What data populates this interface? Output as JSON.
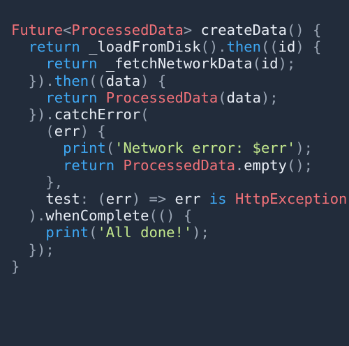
{
  "editor": {
    "colors": {
      "background": "#222c3b",
      "type": "#f07178",
      "keyword": "#3fa9f5",
      "plain": "#e8edf5",
      "punctuation": "#9aa5b4",
      "string": "#c3e88d"
    },
    "lines": [
      {
        "tokens": [
          {
            "t": "Future",
            "c": "type"
          },
          {
            "t": "<",
            "c": "punc"
          },
          {
            "t": "ProcessedData",
            "c": "type"
          },
          {
            "t": "> ",
            "c": "punc"
          },
          {
            "t": "createData",
            "c": "plain"
          },
          {
            "t": "() {",
            "c": "punc"
          }
        ]
      },
      {
        "tokens": [
          {
            "t": "  ",
            "c": "plain"
          },
          {
            "t": "return ",
            "c": "kw"
          },
          {
            "t": "_loadFromDisk",
            "c": "plain"
          },
          {
            "t": "().",
            "c": "punc"
          },
          {
            "t": "then",
            "c": "kw"
          },
          {
            "t": "((",
            "c": "punc"
          },
          {
            "t": "id",
            "c": "plain"
          },
          {
            "t": ") {",
            "c": "punc"
          }
        ]
      },
      {
        "tokens": [
          {
            "t": "    ",
            "c": "plain"
          },
          {
            "t": "return ",
            "c": "kw"
          },
          {
            "t": "_fetchNetworkData",
            "c": "plain"
          },
          {
            "t": "(",
            "c": "punc"
          },
          {
            "t": "id",
            "c": "plain"
          },
          {
            "t": ");",
            "c": "punc"
          }
        ]
      },
      {
        "tokens": [
          {
            "t": "  }).",
            "c": "punc"
          },
          {
            "t": "then",
            "c": "kw"
          },
          {
            "t": "((",
            "c": "punc"
          },
          {
            "t": "data",
            "c": "plain"
          },
          {
            "t": ") {",
            "c": "punc"
          }
        ]
      },
      {
        "tokens": [
          {
            "t": "    ",
            "c": "plain"
          },
          {
            "t": "return ",
            "c": "kw"
          },
          {
            "t": "ProcessedData",
            "c": "type"
          },
          {
            "t": "(",
            "c": "punc"
          },
          {
            "t": "data",
            "c": "plain"
          },
          {
            "t": ");",
            "c": "punc"
          }
        ]
      },
      {
        "tokens": [
          {
            "t": "  }).",
            "c": "punc"
          },
          {
            "t": "catchError",
            "c": "plain"
          },
          {
            "t": "(",
            "c": "punc"
          }
        ]
      },
      {
        "tokens": [
          {
            "t": "    (",
            "c": "punc"
          },
          {
            "t": "err",
            "c": "plain"
          },
          {
            "t": ") {",
            "c": "punc"
          }
        ]
      },
      {
        "tokens": [
          {
            "t": "      ",
            "c": "plain"
          },
          {
            "t": "print",
            "c": "kw"
          },
          {
            "t": "(",
            "c": "punc"
          },
          {
            "t": "'Network error: $err'",
            "c": "str"
          },
          {
            "t": ");",
            "c": "punc"
          }
        ]
      },
      {
        "tokens": [
          {
            "t": "      ",
            "c": "plain"
          },
          {
            "t": "return ",
            "c": "kw"
          },
          {
            "t": "ProcessedData",
            "c": "type"
          },
          {
            "t": ".",
            "c": "punc"
          },
          {
            "t": "empty",
            "c": "plain"
          },
          {
            "t": "();",
            "c": "punc"
          }
        ]
      },
      {
        "tokens": [
          {
            "t": "    },",
            "c": "punc"
          }
        ]
      },
      {
        "tokens": [
          {
            "t": "    ",
            "c": "plain"
          },
          {
            "t": "test",
            "c": "plain"
          },
          {
            "t": ": (",
            "c": "punc"
          },
          {
            "t": "err",
            "c": "plain"
          },
          {
            "t": ") => ",
            "c": "punc"
          },
          {
            "t": "err ",
            "c": "plain"
          },
          {
            "t": "is ",
            "c": "kw"
          },
          {
            "t": "HttpException",
            "c": "type"
          },
          {
            "t": ",",
            "c": "punc"
          }
        ]
      },
      {
        "tokens": [
          {
            "t": "  ).",
            "c": "punc"
          },
          {
            "t": "whenComplete",
            "c": "plain"
          },
          {
            "t": "(() {",
            "c": "punc"
          }
        ]
      },
      {
        "tokens": [
          {
            "t": "    ",
            "c": "plain"
          },
          {
            "t": "print",
            "c": "kw"
          },
          {
            "t": "(",
            "c": "punc"
          },
          {
            "t": "'All done!'",
            "c": "str"
          },
          {
            "t": ");",
            "c": "punc"
          }
        ]
      },
      {
        "tokens": [
          {
            "t": "  });",
            "c": "punc"
          }
        ]
      },
      {
        "tokens": [
          {
            "t": "}",
            "c": "punc"
          }
        ]
      }
    ]
  }
}
